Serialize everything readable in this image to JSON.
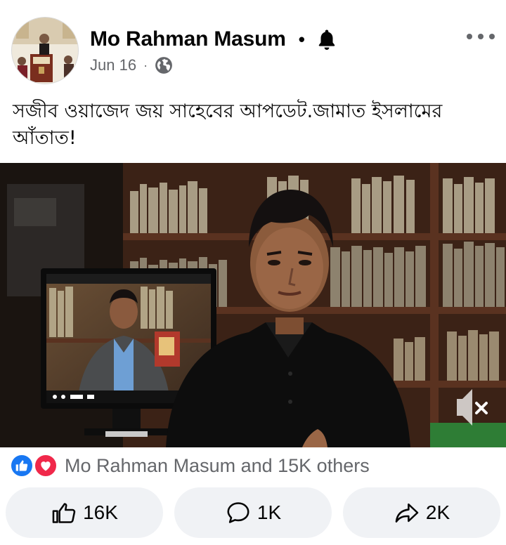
{
  "post": {
    "author": "Mo Rahman Masum",
    "dot": "•",
    "date": "Jun 16",
    "date_sep": "·",
    "audience_icon": "globe-icon",
    "notify_icon": "bell-icon",
    "menu_icon": "more-options-icon",
    "text": "সজীব ওয়াজেদ জয় সাহেবের আপডেট.জামাত ইসলামের আঁতাত!"
  },
  "video": {
    "mute_icon": "speaker-muted-icon"
  },
  "reactions": {
    "icons": [
      "like-reaction-icon",
      "love-reaction-icon"
    ],
    "summary": "Mo Rahman Masum and 15K others"
  },
  "actions": {
    "like_count": "16K",
    "comment_count": "1K",
    "share_count": "2K"
  },
  "colors": {
    "like_blue": "#1877f2",
    "love_red": "#f0284a",
    "secondary_text": "#65676b",
    "button_bg": "#f0f2f5"
  }
}
